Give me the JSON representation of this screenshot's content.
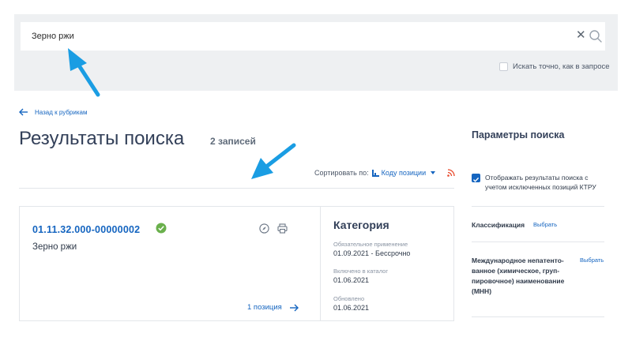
{
  "search": {
    "value": "Зерно ржи",
    "exact_label": "Искать точно, как в запросе"
  },
  "nav": {
    "back_label": "Назад к рубрикам"
  },
  "results": {
    "title": "Результаты поиска",
    "count": "2 записей",
    "sort_label": "Сортировать по:",
    "sort_value": "Коду позиции"
  },
  "card": {
    "code": "01.11.32.000-00000002",
    "name": "Зерно ржи",
    "positions": "1 позиция",
    "category_title": "Категория",
    "mandatory_label": "Обязательное применение",
    "mandatory_value": "01.09.2021  - Бессрочно",
    "included_label": "Включено в каталог",
    "included_value": "01.06.2021",
    "updated_label": "Обновлено",
    "updated_value": "01.06.2021"
  },
  "sidebar": {
    "title": "Параметры поиска",
    "show_excluded_label": "Отображать результаты поиска с учетом исключенных позиций КТРУ",
    "classification_label": "Классификация",
    "classification_select": "Выбрать",
    "mnn_label": "Международное непатенто-ванное (химическое, груп-пировочное) наименование (МНН)",
    "mnn_select": "Выбрать"
  },
  "colors": {
    "accent": "#1565c0",
    "annotation_arrow": "#1a9de3",
    "success": "#6ab04c",
    "rss": "#e8492b"
  }
}
